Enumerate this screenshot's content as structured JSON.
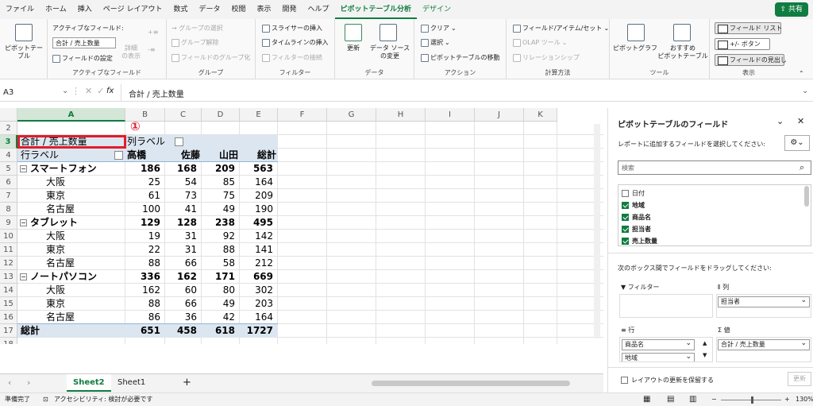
{
  "menu": {
    "items": [
      "ファイル",
      "ホーム",
      "挿入",
      "ページ レイアウト",
      "数式",
      "データ",
      "校閲",
      "表示",
      "開発",
      "ヘルプ"
    ],
    "active": "ピボットテーブル分析",
    "design": "デザイン",
    "share": "共有"
  },
  "ribbon": {
    "pivot_label": "ピボットテー\nブル",
    "active_field_label": "アクティブなフィールド:",
    "active_field_value": "合計 / 売上数量",
    "field_settings": "フィールドの設定",
    "drill": "詳細\nの表示",
    "group_active_field": "アクティブなフィールド",
    "group_select": "→ グループの選択",
    "group_ungroup": "グループ解除",
    "group_field": "フィールドのグループ化",
    "group_group": "グループ",
    "slicer": "スライサーの挿入",
    "timeline": "タイムラインの挿入",
    "filter_conn": "フィルターの接続",
    "group_filter": "フィルター",
    "refresh": "更新",
    "change_source": "データ ソース\nの変更",
    "group_data": "データ",
    "clear": "クリア",
    "select": "選択",
    "move_pivot": "ピボットテーブルの移動",
    "group_action": "アクション",
    "fields_items": "フィールド/アイテム/セット",
    "olap": "OLAP ツール",
    "relations": "リレーションシップ",
    "group_calc": "計算方法",
    "pivot_chart": "ピボットグラフ",
    "recommended": "おすすめ\nピボットテーブル",
    "group_tools": "ツール",
    "field_list": "フィールド リスト",
    "plus_minus": "+/- ボタン",
    "field_headers": "フィールドの見出し",
    "group_show": "表示"
  },
  "formula": {
    "name_box": "A3",
    "fx": "fx",
    "content": "合計 / 売上数量"
  },
  "columns": [
    "A",
    "B",
    "C",
    "D",
    "E",
    "F",
    "G",
    "H",
    "I",
    "J",
    "K"
  ],
  "rows": [
    "2",
    "3",
    "4",
    "5",
    "6",
    "7",
    "8",
    "9",
    "10",
    "11",
    "12",
    "13",
    "14",
    "15",
    "16",
    "17",
    "18",
    "19"
  ],
  "pivot": {
    "a3": "合計 / 売上数量",
    "col_label": "列ラベル",
    "row_label": "行ラベル",
    "headers": [
      "高橋",
      "佐藤",
      "山田",
      "総計"
    ],
    "body": [
      {
        "label": "スマートフォン",
        "group": true,
        "v": [
          "186",
          "168",
          "209",
          "563"
        ]
      },
      {
        "label": "大阪",
        "group": false,
        "v": [
          "25",
          "54",
          "85",
          "164"
        ]
      },
      {
        "label": "東京",
        "group": false,
        "v": [
          "61",
          "73",
          "75",
          "209"
        ]
      },
      {
        "label": "名古屋",
        "group": false,
        "v": [
          "100",
          "41",
          "49",
          "190"
        ]
      },
      {
        "label": "タブレット",
        "group": true,
        "v": [
          "129",
          "128",
          "238",
          "495"
        ]
      },
      {
        "label": "大阪",
        "group": false,
        "v": [
          "19",
          "31",
          "92",
          "142"
        ]
      },
      {
        "label": "東京",
        "group": false,
        "v": [
          "22",
          "31",
          "88",
          "141"
        ]
      },
      {
        "label": "名古屋",
        "group": false,
        "v": [
          "88",
          "66",
          "58",
          "212"
        ]
      },
      {
        "label": "ノートパソコン",
        "group": true,
        "v": [
          "336",
          "162",
          "171",
          "669"
        ]
      },
      {
        "label": "大阪",
        "group": false,
        "v": [
          "162",
          "60",
          "80",
          "302"
        ]
      },
      {
        "label": "東京",
        "group": false,
        "v": [
          "88",
          "66",
          "49",
          "203"
        ]
      },
      {
        "label": "名古屋",
        "group": false,
        "v": [
          "86",
          "36",
          "42",
          "164"
        ]
      }
    ],
    "total_label": "総計",
    "total": [
      "651",
      "458",
      "618",
      "1727"
    ],
    "annotation": "①"
  },
  "tabs": {
    "sheet2": "Sheet2",
    "sheet1": "Sheet1",
    "add": "+"
  },
  "status": {
    "ready": "準備完了",
    "accessibility": "アクセシビリティ: 検討が必要です",
    "zoom": "130%"
  },
  "pane": {
    "title": "ピボットテーブルのフィールド",
    "subtitle": "レポートに追加するフィールドを選択してください:",
    "search": "検索",
    "fields": [
      {
        "name": "日付",
        "checked": false
      },
      {
        "name": "地域",
        "checked": true
      },
      {
        "name": "商品名",
        "checked": true
      },
      {
        "name": "担当者",
        "checked": true
      },
      {
        "name": "売上数量",
        "checked": true
      }
    ],
    "drag_hint": "次のボックス間でフィールドをドラッグしてください:",
    "filter": "フィルター",
    "columns": "列",
    "columns_item": "担当者",
    "rows": "行",
    "rows_items": [
      "商品名",
      "地域"
    ],
    "values": "値",
    "values_item": "合計 / 売上数量",
    "defer": "レイアウトの更新を保留する",
    "update": "更新"
  },
  "colors": {
    "accent": "#107c41",
    "pivot_header": "#dce6f1",
    "highlight": "#e11d2a"
  }
}
